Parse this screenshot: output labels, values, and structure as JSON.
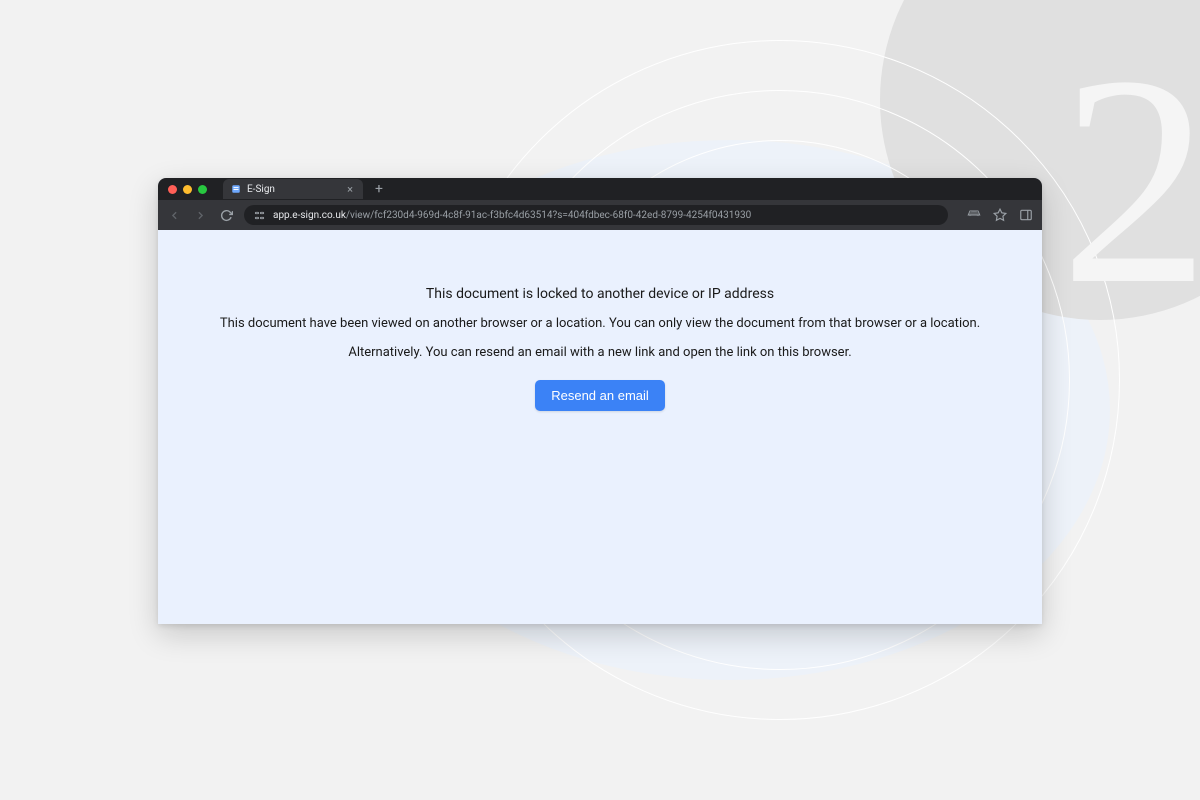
{
  "decor": {
    "step_number": "2"
  },
  "browser": {
    "tab": {
      "title": "E-Sign"
    },
    "url": {
      "domain": "app.e-sign.co.uk",
      "path": "/view/fcf230d4-969d-4c8f-91ac-f3bfc4d63514?s=404fdbec-68f0-42ed-8799-4254f0431930"
    }
  },
  "page": {
    "heading": "This document is locked to another device or IP address",
    "line1": "This document have been viewed on another browser or a location. You can only view the document from that browser or a location.",
    "line2": "Alternatively. You can resend an email with a new link and open the link on this browser.",
    "button_label": "Resend an email"
  }
}
